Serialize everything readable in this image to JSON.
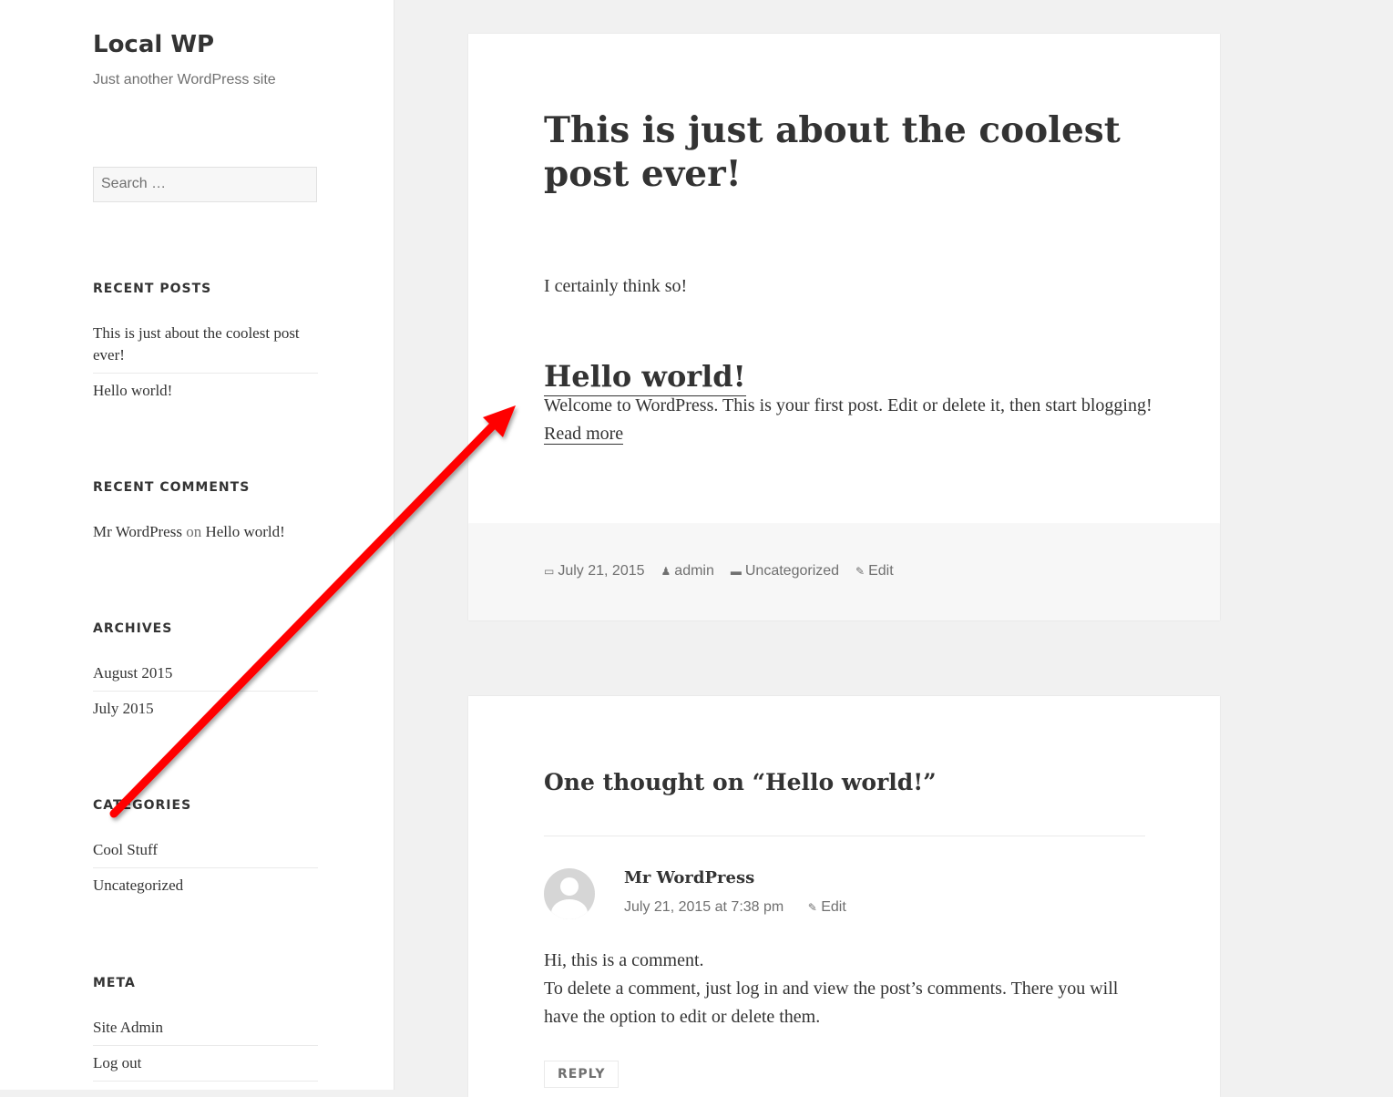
{
  "site": {
    "title": "Local WP",
    "description": "Just another WordPress site"
  },
  "search": {
    "placeholder": "Search …"
  },
  "widgets": {
    "recent_posts": {
      "title": "RECENT POSTS",
      "items": [
        "This is just about the coolest post ever!",
        "Hello world!"
      ]
    },
    "recent_comments": {
      "title": "RECENT COMMENTS",
      "author": "Mr WordPress",
      "on": "on",
      "post": "Hello world!"
    },
    "archives": {
      "title": "ARCHIVES",
      "items": [
        "August 2015",
        "July 2015"
      ]
    },
    "categories": {
      "title": "CATEGORIES",
      "items": [
        "Cool Stuff",
        "Uncategorized"
      ]
    },
    "meta": {
      "title": "META",
      "items": [
        "Site Admin",
        "Log out"
      ]
    }
  },
  "post": {
    "title": "This is just about the coolest post ever!",
    "paragraph": "I certainly think so!",
    "embedded_heading": "Hello world!",
    "excerpt": "Welcome to WordPress. This is your first post. Edit or delete it, then start blogging!",
    "read_more": "Read more",
    "footer": {
      "date": "July 21, 2015",
      "author": "admin",
      "category": "Uncategorized",
      "edit": "Edit"
    }
  },
  "comments": {
    "title": "One thought on “Hello world!”",
    "comment": {
      "author": "Mr WordPress",
      "datetime": "July 21, 2015 at 7:38 pm",
      "edit": "Edit",
      "line1": "Hi, this is a comment.",
      "line2": "To delete a comment, just log in and view the post’s comments. There you will have the option to edit or delete them.",
      "reply": "REPLY"
    }
  },
  "annotation": {
    "arrow_color": "#ff0000"
  }
}
